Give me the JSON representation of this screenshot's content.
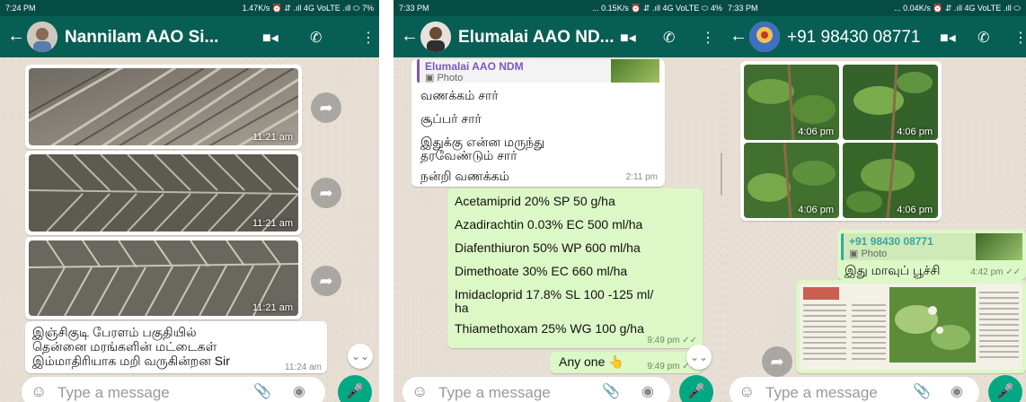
{
  "panel1": {
    "status": {
      "time": "7:24 PM",
      "network": "1.47K/s ⏰ ⇵ .ıll 4G VoLTE .ıll ⬭ 7%"
    },
    "header": {
      "title": "Nannilam AAO Si..."
    },
    "photos": [
      {
        "time": "11:21 am"
      },
      {
        "time": "11:21 am"
      },
      {
        "time": "11:21 am"
      }
    ],
    "message": {
      "lines": [
        "இஞ்சிகுடி பேரளம் பகுதியில்",
        "தென்னை மரங்களின் மட்டைகள்",
        "இம்மாதிரியாக மறி வருகின்றன Sir"
      ],
      "time": "11:24 am"
    },
    "input": {
      "placeholder": "Type a message"
    }
  },
  "panel2": {
    "status": {
      "time": "7:33 PM",
      "network": "... 0.15K/s ⏰ ⇵ .ıll 4G VoLTE ⬭ 4%"
    },
    "header": {
      "title": "Elumalai AAO ND..."
    },
    "quoted": {
      "sender": "Elumalai AAO NDM",
      "label": "Photo"
    },
    "incoming": [
      {
        "text": "வணக்கம் சார்"
      },
      {
        "text": "சூப்பர் சார்"
      },
      {
        "text": "இதுக்கு என்ன மருந்து"
      },
      {
        "text": "தரவேண்டும் சார்"
      },
      {
        "text": "நன்றி வணக்கம்"
      }
    ],
    "incoming_time": "2:11 pm",
    "outgoing": [
      {
        "text": "Acetamiprid 20% SP 50 g/ha"
      },
      {
        "text": "Azadirachtin 0.03% EC 500 ml/ha"
      },
      {
        "text": "Diafenthiuron 50% WP 600 ml/ha"
      },
      {
        "text": "Dimethoate 30% EC 660 ml/ha"
      },
      {
        "text": "Imidacloprid 17.8% SL 100 -125 ml/"
      },
      {
        "text": "ha"
      },
      {
        "text": "Thiamethoxam 25% WG 100 g/ha"
      }
    ],
    "outgoing_time": "9:49 pm ✓✓",
    "any_one": {
      "text": "Any one 👆",
      "time": "9:49 pm ✓✓"
    },
    "input": {
      "placeholder": "Type a message"
    }
  },
  "panel3": {
    "status": {
      "time": "7:33 PM",
      "network": "... 0.04K/s ⏰ ⇵ .ıll 4G VoLTE .ıll ⬭"
    },
    "header": {
      "title": "+91 98430 08771"
    },
    "grid_times": [
      "4:06 pm",
      "4:06 pm",
      "4:06 pm",
      "4:06 pm"
    ],
    "quoted": {
      "sender": "+91 98430 08771",
      "label": "Photo"
    },
    "reply": {
      "text": "இது மாவுப் பூச்சி",
      "time": "4:42 pm ✓✓"
    },
    "input": {
      "placeholder": "Type a message"
    }
  },
  "colors": {
    "header": "#075e54",
    "statusbar": "#054d44",
    "outgoing": "#dcf8c6",
    "mic": "#00a884",
    "wallpaper": "#e7dfd4"
  },
  "icons": [
    "back-arrow-icon",
    "video-call-icon",
    "phone-icon",
    "more-vert-icon",
    "forward-icon",
    "emoji-icon",
    "attach-icon",
    "camera-icon",
    "mic-icon",
    "scroll-down-icon"
  ]
}
